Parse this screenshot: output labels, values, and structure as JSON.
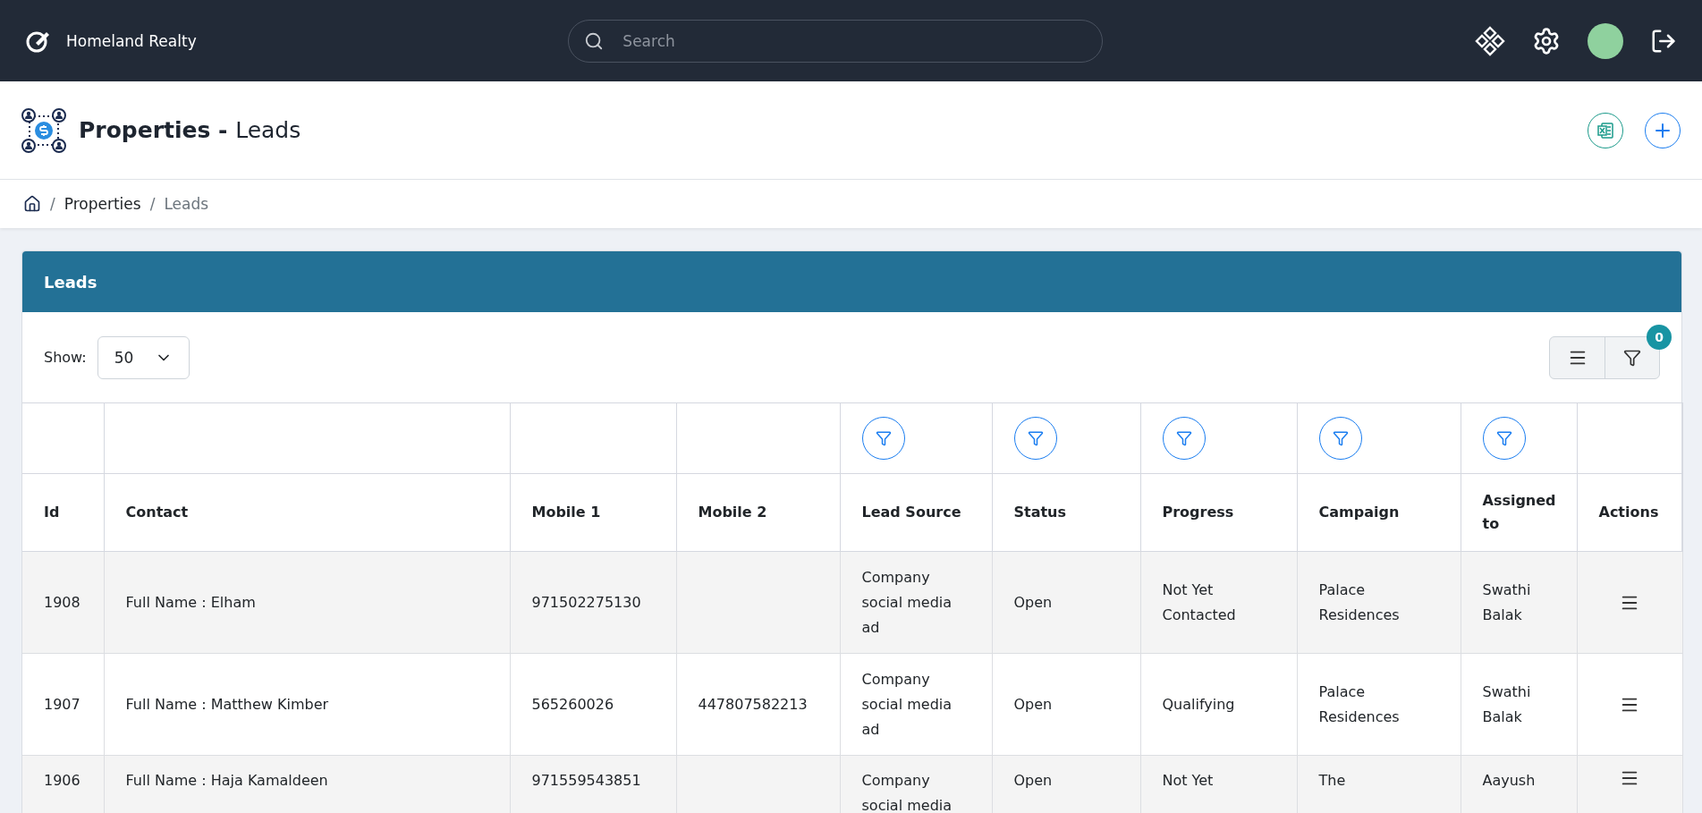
{
  "topbar": {
    "brand": "Homeland Realty",
    "search": {
      "placeholder": "Search"
    }
  },
  "header": {
    "title": "Properties -",
    "subtitle": "Leads"
  },
  "breadcrumb": [
    {
      "separator": "/",
      "label": "Properties",
      "current": false
    },
    {
      "separator": "/",
      "label": "Leads",
      "current": true
    }
  ],
  "card": {
    "title": "Leads",
    "show_label": "Show:",
    "page_size": "50",
    "filter_count": "0"
  },
  "table": {
    "columns": [
      {
        "label": "Id",
        "filter": false
      },
      {
        "label": "Contact",
        "filter": false
      },
      {
        "label": "Mobile 1",
        "filter": false
      },
      {
        "label": "Mobile 2",
        "filter": false
      },
      {
        "label": "Lead Source",
        "filter": true
      },
      {
        "label": "Status",
        "filter": true
      },
      {
        "label": "Progress",
        "filter": true
      },
      {
        "label": "Campaign",
        "filter": true
      },
      {
        "label": "Assigned to",
        "filter": true
      },
      {
        "label": "Actions",
        "filter": false
      }
    ],
    "rows": [
      {
        "cells": [
          "1908",
          "Full Name : Elham",
          "971502275130",
          "",
          "Company social media ad",
          "Open",
          "Not Yet Contacted",
          "Palace Residences",
          "Swathi Balak"
        ]
      },
      {
        "cells": [
          "1907",
          "Full Name : Matthew Kimber",
          "565260026",
          "447807582213",
          "Company social media ad",
          "Open",
          "Qualifying",
          "Palace Residences",
          "Swathi Balak"
        ]
      },
      {
        "cells": [
          "1906",
          "Full Name : Haja Kamaldeen",
          "971559543851",
          "",
          "Company social media",
          "Open",
          "Not Yet",
          "The",
          "Aayush"
        ]
      }
    ]
  }
}
